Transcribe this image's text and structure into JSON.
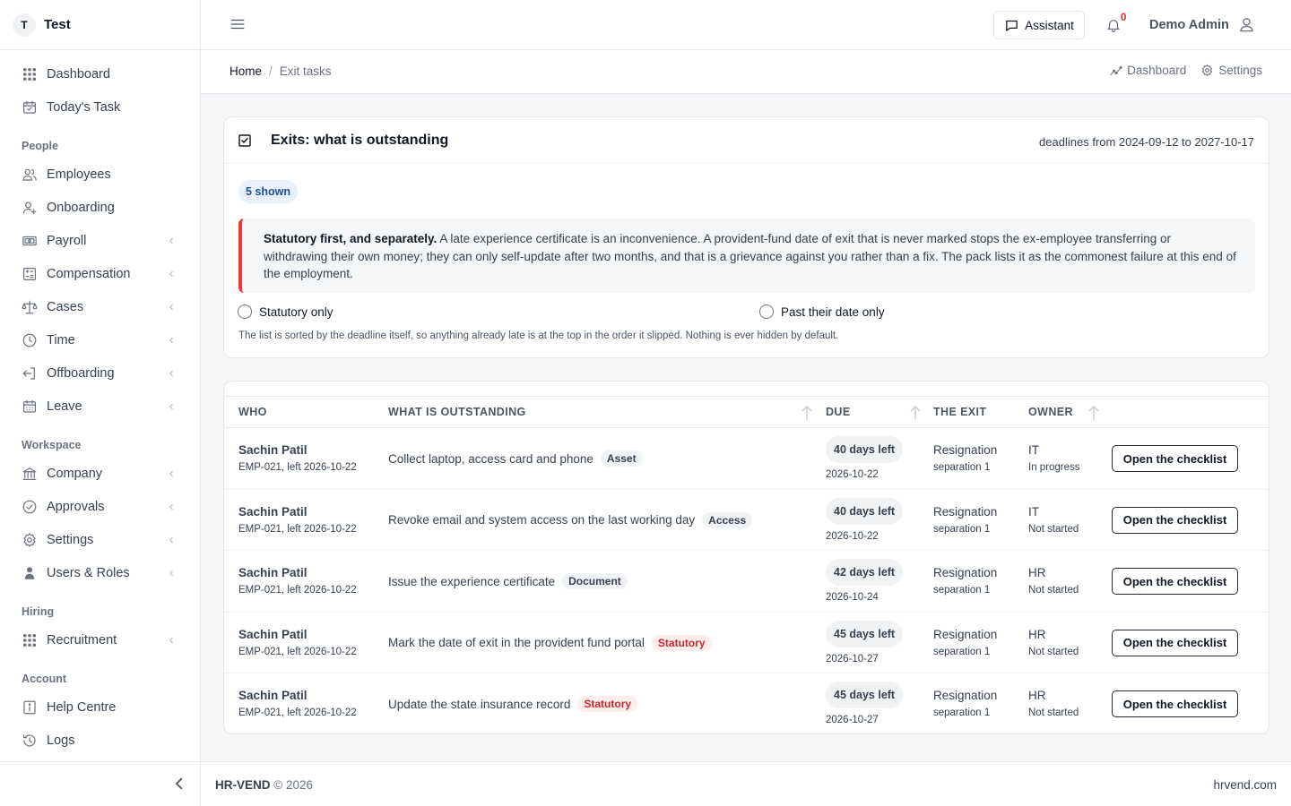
{
  "brand": {
    "initial": "T",
    "name": "Test"
  },
  "sidebar": {
    "top": [
      {
        "label": "Dashboard",
        "icon": "grid-dots-icon",
        "chevron": false
      },
      {
        "label": "Today's Task",
        "icon": "calendar-check-icon",
        "chevron": false
      }
    ],
    "sections": [
      {
        "heading": "People",
        "items": [
          {
            "label": "Employees",
            "icon": "users-icon",
            "chevron": false
          },
          {
            "label": "Onboarding",
            "icon": "user-plus-icon",
            "chevron": false
          },
          {
            "label": "Payroll",
            "icon": "money-icon",
            "chevron": true
          },
          {
            "label": "Compensation",
            "icon": "calculator-icon",
            "chevron": true
          },
          {
            "label": "Cases",
            "icon": "scale-icon",
            "chevron": true
          },
          {
            "label": "Time",
            "icon": "clock-icon",
            "chevron": true
          },
          {
            "label": "Offboarding",
            "icon": "exit-icon",
            "chevron": true
          },
          {
            "label": "Leave",
            "icon": "calendar-icon",
            "chevron": true
          }
        ]
      },
      {
        "heading": "Workspace",
        "items": [
          {
            "label": "Company",
            "icon": "bank-icon",
            "chevron": true
          },
          {
            "label": "Approvals",
            "icon": "check-circle-icon",
            "chevron": true
          },
          {
            "label": "Settings",
            "icon": "gear-icon",
            "chevron": true
          },
          {
            "label": "Users & Roles",
            "icon": "user-lock-icon",
            "chevron": true
          }
        ]
      },
      {
        "heading": "Hiring",
        "items": [
          {
            "label": "Recruitment",
            "icon": "grid-dots-icon",
            "chevron": true
          }
        ]
      },
      {
        "heading": "Account",
        "items": [
          {
            "label": "Help Centre",
            "icon": "info-icon",
            "chevron": false
          },
          {
            "label": "Logs",
            "icon": "history-icon",
            "chevron": false
          }
        ]
      }
    ]
  },
  "header": {
    "assistant_label": "Assistant",
    "notif_count": "0",
    "user_name": "Demo Admin"
  },
  "breadcrumb": {
    "home": "Home",
    "sep": "/",
    "current": "Exit tasks",
    "links": [
      "Dashboard",
      "Settings"
    ]
  },
  "card": {
    "title": "Exits: what is outstanding",
    "range": "deadlines from 2024-09-12 to 2027-10-17",
    "shown": "5 shown",
    "callout_bold": "Statutory first, and separately.",
    "callout_text": " A late experience certificate is an inconvenience. A provident-fund date of exit that is never marked stops the ex-employee transferring or withdrawing their own money; they can only self-update after two months, and that is a grievance against you rather than a fix. The pack lists it as the commonest failure at this end of the employment.",
    "filter1": "Statutory only",
    "filter2": "Past their date only",
    "hint": "The list is sorted by the deadline itself, so anything already late is at the top in the order it slipped. Nothing is ever hidden by default."
  },
  "table": {
    "headers": {
      "who": "WHO",
      "what": "WHAT IS OUTSTANDING",
      "due": "DUE",
      "exit": "THE EXIT",
      "owner": "OWNER"
    },
    "button_label": "Open the checklist",
    "rows": [
      {
        "name": "Sachin Patil",
        "sub": "EMP-021, left 2026-10-22",
        "task": "Collect laptop, access card and phone",
        "tag": "Asset",
        "statutory": false,
        "due": "40 days left",
        "due_date": "2026-10-22",
        "exit": "Resignation",
        "exit_sub": "separation 1",
        "owner": "IT",
        "status": "In progress"
      },
      {
        "name": "Sachin Patil",
        "sub": "EMP-021, left 2026-10-22",
        "task": "Revoke email and system access on the last working day",
        "tag": "Access",
        "statutory": false,
        "due": "40 days left",
        "due_date": "2026-10-22",
        "exit": "Resignation",
        "exit_sub": "separation 1",
        "owner": "IT",
        "status": "Not started"
      },
      {
        "name": "Sachin Patil",
        "sub": "EMP-021, left 2026-10-22",
        "task": "Issue the experience certificate",
        "tag": "Document",
        "statutory": false,
        "due": "42 days left",
        "due_date": "2026-10-24",
        "exit": "Resignation",
        "exit_sub": "separation 1",
        "owner": "HR",
        "status": "Not started"
      },
      {
        "name": "Sachin Patil",
        "sub": "EMP-021, left 2026-10-22",
        "task": "Mark the date of exit in the provident fund portal",
        "tag": "Statutory",
        "statutory": true,
        "due": "45 days left",
        "due_date": "2026-10-27",
        "exit": "Resignation",
        "exit_sub": "separation 1",
        "owner": "HR",
        "status": "Not started"
      },
      {
        "name": "Sachin Patil",
        "sub": "EMP-021, left 2026-10-22",
        "task": "Update the state insurance record",
        "tag": "Statutory",
        "statutory": true,
        "due": "45 days left",
        "due_date": "2026-10-27",
        "exit": "Resignation",
        "exit_sub": "separation 1",
        "owner": "HR",
        "status": "Not started"
      }
    ]
  },
  "footer": {
    "brand": "HR-VEND",
    "copy": "© 2026",
    "site": "hrvend.com"
  },
  "colors": {
    "accent_red": "#e23c3c",
    "statutory_text": "#c62828",
    "shown_pill_bg": "#e8f0fb",
    "shown_pill_text": "#1f4f99"
  }
}
